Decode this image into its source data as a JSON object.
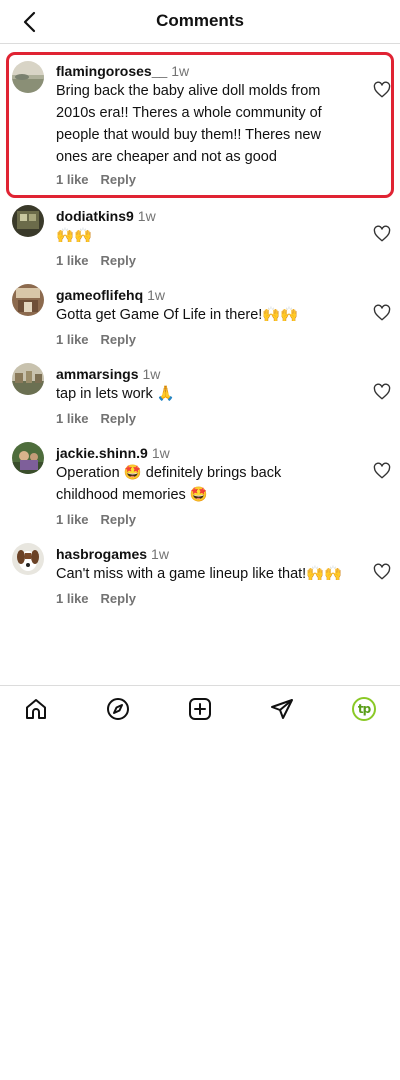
{
  "header": {
    "title": "Comments"
  },
  "comments": [
    {
      "username": "flamingoroses__",
      "time": "1w",
      "text": "Bring back the baby alive doll molds from 2010s era!! Theres a whole community of people that would buy them!! Theres new ones are cheaper and not as good",
      "likes": "1 like",
      "reply": "Reply",
      "highlighted": true
    },
    {
      "username": "dodiatkins9",
      "time": "1w",
      "text": "🙌🙌",
      "likes": "1 like",
      "reply": "Reply"
    },
    {
      "username": "gameoflifehq",
      "time": "1w",
      "text": "Gotta get Game Of Life in there!🙌🙌",
      "likes": "1 like",
      "reply": "Reply"
    },
    {
      "username": "ammarsings",
      "time": "1w",
      "text": "tap in lets work 🙏",
      "likes": "1 like",
      "reply": "Reply"
    },
    {
      "username": "jackie.shinn.9",
      "time": "1w",
      "text": "Operation 🤩 definitely brings back childhood memories 🤩",
      "likes": "1 like",
      "reply": "Reply"
    },
    {
      "username": "hasbrogames",
      "time": "1w",
      "text": "Can't miss with a game lineup like that!🙌🙌",
      "likes": "1 like",
      "reply": "Reply"
    }
  ],
  "bottom_nav": {
    "items": [
      "home-icon",
      "explore-icon",
      "create-icon",
      "send-icon",
      "profile-icon"
    ],
    "profile_logo_text": "tp"
  }
}
